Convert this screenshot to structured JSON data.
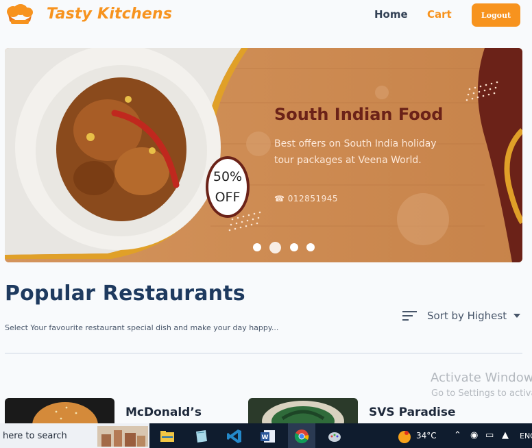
{
  "header": {
    "brand": "Tasty Kitchens",
    "nav_home": "Home",
    "nav_cart": "Cart",
    "logout": "Logout"
  },
  "banner": {
    "title": "South Indian Food",
    "description": "Best offers on South India holiday tour packages at Veena World.",
    "phone": "012851945",
    "offer_top": "50%",
    "offer_bottom": "OFF",
    "slides_count": 4,
    "active_slide": 2
  },
  "section": {
    "title": "Popular Restaurants",
    "subtitle": "Select Your favourite restaurant special dish and make your day happy...",
    "sort_label": "Sort by Highest"
  },
  "restaurants": [
    {
      "name": "McDonald’s"
    },
    {
      "name": "SVS Paradise"
    }
  ],
  "watermark": {
    "title": "Activate Windows",
    "subtitle": "Go to Settings to activate Windows."
  },
  "taskbar": {
    "search_placeholder": "here to search",
    "temperature": "34°C",
    "language": "ENG"
  },
  "colors": {
    "accent": "#f7931e",
    "heading": "#1e3a5f",
    "banner_title": "#6b2218",
    "taskbar": "#0f1c2e"
  }
}
